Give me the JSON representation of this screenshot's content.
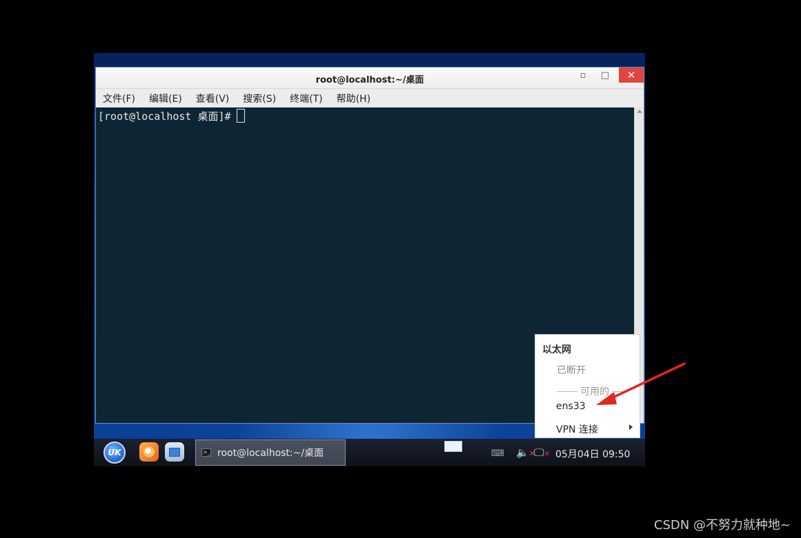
{
  "window": {
    "title": "root@localhost:~/桌面",
    "minimize_glyph": "▫",
    "maximize_glyph": "□",
    "close_glyph": "✕"
  },
  "menubar": {
    "items": [
      {
        "label": "文件(F)"
      },
      {
        "label": "编辑(E)"
      },
      {
        "label": "查看(V)"
      },
      {
        "label": "搜索(S)"
      },
      {
        "label": "终端(T)"
      },
      {
        "label": "帮助(H)"
      }
    ]
  },
  "terminal": {
    "prompt": "[root@localhost 桌面]#"
  },
  "network_popup": {
    "header": "以太网",
    "status": "已断开",
    "available_label": "可用的",
    "connection": "ens33",
    "vpn_label": "VPN 连接"
  },
  "taskbar": {
    "start_label": "UK",
    "task_label": "root@localhost:~/桌面",
    "clock": "05月04日 09:50",
    "keyboard_glyph": "⌨",
    "volume_glyph": "🔈",
    "network_glyph": "🖵",
    "muted_glyph": "✕"
  },
  "annotation": {
    "arrow_color": "#e3261f"
  },
  "watermark": "CSDN @不努力就种地~"
}
